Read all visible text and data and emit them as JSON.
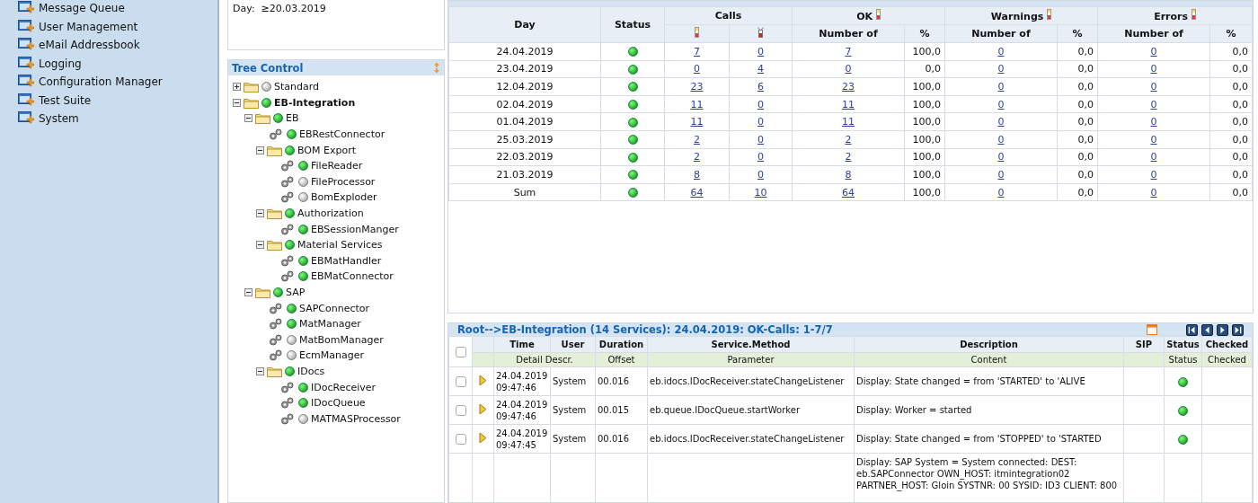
{
  "sidebar": {
    "items": [
      {
        "label": "Message Queue"
      },
      {
        "label": "User Management"
      },
      {
        "label": "eMail Addressbook"
      },
      {
        "label": "Logging"
      },
      {
        "label": "Configuration Manager"
      },
      {
        "label": "Test Suite"
      },
      {
        "label": "System"
      }
    ]
  },
  "filter": {
    "label": "Day:",
    "value": "≥20.03.2019"
  },
  "tree": {
    "title": "Tree Control",
    "nodes": [
      {
        "kind": "folder",
        "label": "Standard",
        "active": false,
        "expanded": false,
        "selected": false
      },
      {
        "kind": "folder",
        "label": "EB-Integration",
        "active": true,
        "expanded": true,
        "selected": true,
        "children": [
          {
            "kind": "folder",
            "label": "EB",
            "active": true,
            "expanded": true,
            "selected": false,
            "children": [
              {
                "kind": "service",
                "label": "EBRestConnector",
                "active": true,
                "selected": false
              },
              {
                "kind": "folder",
                "label": "BOM Export",
                "active": true,
                "expanded": true,
                "selected": false,
                "children": [
                  {
                    "kind": "service",
                    "label": "FileReader",
                    "active": true,
                    "selected": false
                  },
                  {
                    "kind": "service",
                    "label": "FileProcessor",
                    "active": false,
                    "selected": false
                  },
                  {
                    "kind": "service",
                    "label": "BomExploder",
                    "active": false,
                    "selected": false
                  }
                ]
              },
              {
                "kind": "folder",
                "label": "Authorization",
                "active": true,
                "expanded": true,
                "selected": false,
                "children": [
                  {
                    "kind": "service",
                    "label": "EBSessionManger",
                    "active": true,
                    "selected": false
                  }
                ]
              },
              {
                "kind": "folder",
                "label": "Material Services",
                "active": true,
                "expanded": true,
                "selected": false,
                "children": [
                  {
                    "kind": "service",
                    "label": "EBMatHandler",
                    "active": true,
                    "selected": false
                  },
                  {
                    "kind": "service",
                    "label": "EBMatConnector",
                    "active": true,
                    "selected": false
                  }
                ]
              }
            ]
          },
          {
            "kind": "folder",
            "label": "SAP",
            "active": true,
            "expanded": true,
            "selected": false,
            "children": [
              {
                "kind": "service",
                "label": "SAPConnector",
                "active": true,
                "selected": false
              },
              {
                "kind": "service",
                "label": "MatManager",
                "active": true,
                "selected": false
              },
              {
                "kind": "service",
                "label": "MatBomManager",
                "active": false,
                "selected": false
              },
              {
                "kind": "service",
                "label": "EcmManager",
                "active": false,
                "selected": false
              },
              {
                "kind": "folder",
                "label": "IDocs",
                "active": true,
                "expanded": true,
                "selected": false,
                "children": [
                  {
                    "kind": "service",
                    "label": "IDocReceiver",
                    "active": true,
                    "selected": false
                  },
                  {
                    "kind": "service",
                    "label": "IDocQueue",
                    "active": true,
                    "selected": false
                  },
                  {
                    "kind": "service",
                    "label": "MATMASProcessor",
                    "active": false,
                    "selected": false
                  }
                ]
              }
            ]
          }
        ]
      }
    ]
  },
  "stats": {
    "headers": {
      "day": "Day",
      "status": "Status",
      "calls": "Calls",
      "ok": "OK",
      "warnings": "Warnings",
      "errors": "Errors",
      "number_of": [
        "Number of",
        "Number of",
        "Number of"
      ],
      "percent": [
        "%",
        "%",
        "%"
      ]
    },
    "rows": [
      {
        "day": "24.04.2019",
        "active": true,
        "calls_ok": "7",
        "calls_failed": "0",
        "ok_count": "7",
        "ok_pct": "100,0",
        "warn_count": "0",
        "warn_pct": "0,0",
        "err_count": "0",
        "err_pct": "0,0"
      },
      {
        "day": "23.04.2019",
        "active": true,
        "calls_ok": "0",
        "calls_failed": "4",
        "ok_count": "0",
        "ok_pct": "0,0",
        "warn_count": "0",
        "warn_pct": "0,0",
        "err_count": "0",
        "err_pct": "0,0"
      },
      {
        "day": "12.04.2019",
        "active": true,
        "calls_ok": "23",
        "calls_failed": "6",
        "ok_count": "23",
        "ok_pct": "100,0",
        "warn_count": "0",
        "warn_pct": "0,0",
        "err_count": "0",
        "err_pct": "0,0"
      },
      {
        "day": "02.04.2019",
        "active": true,
        "calls_ok": "11",
        "calls_failed": "0",
        "ok_count": "11",
        "ok_pct": "100,0",
        "warn_count": "0",
        "warn_pct": "0,0",
        "err_count": "0",
        "err_pct": "0,0"
      },
      {
        "day": "01.04.2019",
        "active": true,
        "calls_ok": "11",
        "calls_failed": "0",
        "ok_count": "11",
        "ok_pct": "100,0",
        "warn_count": "0",
        "warn_pct": "0,0",
        "err_count": "0",
        "err_pct": "0,0"
      },
      {
        "day": "25.03.2019",
        "active": true,
        "calls_ok": "2",
        "calls_failed": "0",
        "ok_count": "2",
        "ok_pct": "100,0",
        "warn_count": "0",
        "warn_pct": "0,0",
        "err_count": "0",
        "err_pct": "0,0"
      },
      {
        "day": "22.03.2019",
        "active": true,
        "calls_ok": "2",
        "calls_failed": "0",
        "ok_count": "2",
        "ok_pct": "100,0",
        "warn_count": "0",
        "warn_pct": "0,0",
        "err_count": "0",
        "err_pct": "0,0"
      },
      {
        "day": "21.03.2019",
        "active": true,
        "calls_ok": "8",
        "calls_failed": "0",
        "ok_count": "8",
        "ok_pct": "100,0",
        "warn_count": "0",
        "warn_pct": "0,0",
        "err_count": "0",
        "err_pct": "0,0"
      },
      {
        "day": "Sum",
        "active": true,
        "calls_ok": "64",
        "calls_failed": "10",
        "ok_count": "64",
        "ok_pct": "100,0",
        "warn_count": "0",
        "warn_pct": "0,0",
        "err_count": "0",
        "err_pct": "0,0"
      }
    ]
  },
  "log": {
    "title": "Root-->EB-Integration (14 Services): 24.04.2019: OK-Calls: 1-7/7",
    "columns": [
      "Time",
      "User",
      "Duration",
      "Service.Method",
      "Description",
      "SIP",
      "Status",
      "Checked"
    ],
    "subcolumns": [
      "Detail Descr.",
      "Offset",
      "Parameter",
      "Content",
      "Status",
      "Checked"
    ],
    "select_all_checked": false,
    "rows": [
      {
        "checked": false,
        "date": "24.04.2019",
        "time": "09:47:46",
        "user": "System",
        "duration": "00.016",
        "method": "eb.idocs.IDocReceiver.stateChangeListener",
        "description": "Display: State changed = from 'STARTED' to 'ALIVE",
        "active": true
      },
      {
        "checked": false,
        "date": "24.04.2019",
        "time": "09:47:46",
        "user": "System",
        "duration": "00.015",
        "method": "eb.queue.IDocQueue.startWorker",
        "description": "Display: Worker = started",
        "active": true
      },
      {
        "checked": false,
        "date": "24.04.2019",
        "time": "09:47:45",
        "user": "System",
        "duration": "00.016",
        "method": "eb.idocs.IDocReceiver.stateChangeListener",
        "description": "Display: State changed = from 'STOPPED' to 'STARTED",
        "active": true
      }
    ],
    "detail_row": {
      "content": "Display: SAP System = System connected: DEST: eb.SAPConnector OWN_HOST: itmintegration02 PARTNER_HOST: Gloin SYSTNR: 00 SYSID: ID3 CLIENT: 800"
    }
  }
}
